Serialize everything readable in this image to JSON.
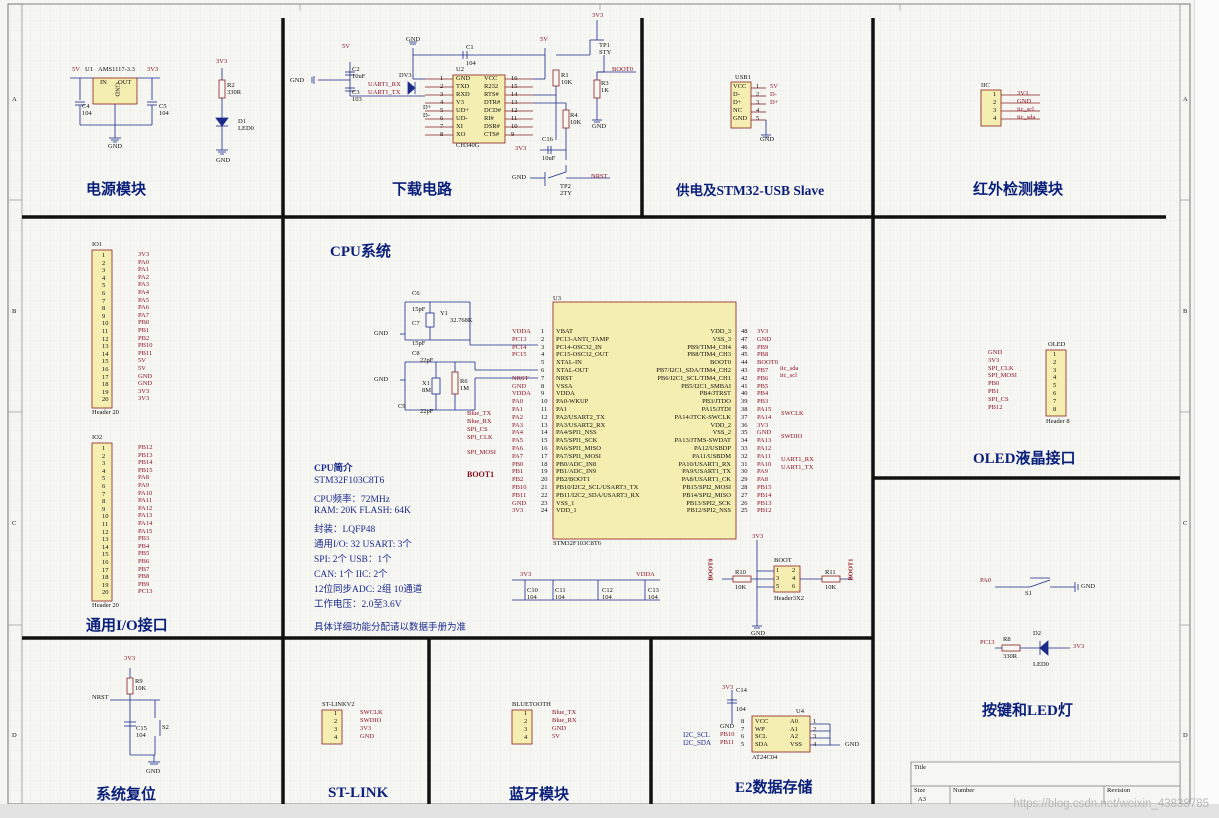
{
  "sheet": {
    "border_rows": [
      "A",
      "B",
      "C",
      "D"
    ],
    "watermark": "https://blog.csdn.net/weixin_43838785"
  },
  "sections": {
    "power": "电源模块",
    "download": "下载电路",
    "usb": "供电及STM32-USB Slave",
    "ir": "红外检测模块",
    "cpu": "CPU系统",
    "oled": "OLED液晶接口",
    "io": "通用I/O接口",
    "keyled": "按键和LED灯",
    "reset": "系统复位",
    "stlink": "ST-LINK",
    "bluetooth": "蓝牙模块",
    "e2": "E2数据存储"
  },
  "cpu_info": {
    "heading": "CPU简介",
    "lines": [
      "STM32F103C8T6",
      "CPU频率：72MHz",
      "RAM:  20K  FLASH:  64K",
      "封装：LQFP48",
      "通用I/O:  32      USART:  3个",
      "SPI:  2个            USB：1个",
      "CAN:  1个           IIC:  2个",
      "12位同步ADC:  2组  10通道",
      "工作电压：2.0至3.6V",
      "具体详细功能分配请以数据手册为准"
    ]
  },
  "power_parts": {
    "ldo": "AMS1117-3.3",
    "u1": "U1",
    "in": "IN",
    "out": "OUT",
    "gnd_pin": "GND",
    "v5": "5V",
    "v33": "3V3",
    "c4": "C4",
    "c4v": "104",
    "c5": "C5",
    "c5v": "104",
    "r2": "R2",
    "r2v": "330R",
    "d1": "D1",
    "d1v": "LED0",
    "gnd": "GND"
  },
  "download_parts": {
    "u2": "U2",
    "u2v": "CH340G",
    "left_pins": [
      "GND",
      "TXD",
      "RXD",
      "V3",
      "UD+",
      "UD-",
      "XI",
      "XO"
    ],
    "right_pins": [
      "VCC",
      "R232",
      "RTS#",
      "DTR#",
      "DCD#",
      "RI#",
      "DSR#",
      "CTS#"
    ],
    "left_nums": [
      "1",
      "2",
      "3",
      "4",
      "5",
      "6",
      "7",
      "8"
    ],
    "right_nums": [
      "16",
      "15",
      "14",
      "13",
      "12",
      "11",
      "10",
      "9"
    ],
    "uart_rx": "UART1_RX",
    "uart_tx": "UART1_TX",
    "dv3": "DV3",
    "c1": "C1",
    "c1v": "104",
    "c2": "C2",
    "c2v": "10uF",
    "c3": "C3",
    "c3v": "103",
    "c16": "C16",
    "c16v": "10uF",
    "r1": "R1",
    "r1v": "10K",
    "r3": "R3",
    "r3v": "1K",
    "r4": "R4",
    "r4v": "10K",
    "tp1": "TP1",
    "tp1v": "STY",
    "tp2": "TP2",
    "tp2v": "2TY",
    "boot0": "BOOT0",
    "nrst": "NRST",
    "v5": "5V",
    "v33": "3V3",
    "gnd": "GND",
    "dplus": "D+",
    "dminus": "D-"
  },
  "usb_parts": {
    "usb1": "USB1",
    "pins": [
      "VCC",
      "D-",
      "D+",
      "NC",
      "GND"
    ],
    "nums": [
      "1",
      "2",
      "3",
      "4",
      "5"
    ],
    "nets": [
      "5V",
      "D-",
      "D+",
      "",
      ""
    ],
    "gnd": "GND"
  },
  "ir_parts": {
    "iic": "IIC",
    "nums": [
      "1",
      "2",
      "3",
      "4"
    ],
    "nets": [
      "3V3",
      "GND",
      "iic_scl",
      "iic_sda"
    ]
  },
  "cpu_parts": {
    "u3": "U3",
    "u3v": "STM32F103C8T6",
    "left_pins": [
      "VBAT",
      "PC13-ANTI_TAMP",
      "PC14-OSC32_IN",
      "PC15-OSC32_OUT",
      "XTAL-IN",
      "XTAL-OUT",
      "NRST",
      "VSSA",
      "VDDA",
      "PA0-WKUP",
      "PA1",
      "PA2/USART2_TX",
      "PA3/USART2_RX",
      "PA4/SPI1_NSS",
      "PA5/SPI1_SCK",
      "PA6/SPI1_MISO",
      "PA7/SPI1_MOSI",
      "PB0/ADC_IN8",
      "PB1/ADC_IN9",
      "PB2/BOOT1",
      "PB10/I2C2_SCL/USART3_TX",
      "PB11/I2C2_SDA/USART3_RX",
      "VSS_1",
      "VDD_1"
    ],
    "left_nums": [
      "1",
      "2",
      "3",
      "4",
      "5",
      "6",
      "7",
      "8",
      "9",
      "10",
      "11",
      "12",
      "13",
      "14",
      "15",
      "16",
      "17",
      "18",
      "19",
      "20",
      "21",
      "22",
      "23",
      "24"
    ],
    "left_nets": [
      "VDDA",
      "PC13",
      "PC14",
      "PC15",
      "",
      "",
      "NRST",
      "GND",
      "VDDA",
      "PA0",
      "PA1",
      "PA2",
      "PA3",
      "PA4",
      "PA5",
      "PA6",
      "PA7",
      "PB0",
      "PB1",
      "PB2",
      "PB10",
      "PB11",
      "GND",
      "3V3"
    ],
    "right_pins": [
      "VDD_3",
      "VSS_3",
      "PB9/TIM4_CH4",
      "PB8/TIM4_CH3",
      "BOOT0",
      "PB7/I2C1_SDA/TIM4_CH2",
      "PB6/I2C1_SCL/TIM4_CH1",
      "PB5/I2C1_SMBAI",
      "PB4/JTRST",
      "PB3/JTDO",
      "PA15/JTDI",
      "PA14/JTCK-SWCLK",
      "VDD_2",
      "VSS_2",
      "PA13/JTMS-SWDAT",
      "PA12/USBDP",
      "PA11/USBDM",
      "PA10/USART1_RX",
      "PA9/USART1_TX",
      "PA8/USART1_CK",
      "PB15/SPI2_MOSI",
      "PB14/SPI2_MISO",
      "PB13/SPI2_SCK",
      "PB12/SPI2_NSS"
    ],
    "right_nums": [
      "48",
      "47",
      "46",
      "45",
      "44",
      "43",
      "42",
      "41",
      "40",
      "39",
      "38",
      "37",
      "36",
      "35",
      "34",
      "33",
      "32",
      "31",
      "30",
      "29",
      "28",
      "27",
      "26",
      "25"
    ],
    "right_nets": [
      "3V3",
      "GND",
      "PB9",
      "PB8",
      "BOOT0",
      "PB7",
      "PB6",
      "PB5",
      "PB4",
      "PB3",
      "PA15",
      "PA14",
      "3V3",
      "GND",
      "PA13",
      "PA12",
      "PA11",
      "PA10",
      "PA9",
      "PA8",
      "PB15",
      "PB14",
      "PB13",
      "PB12"
    ],
    "left_sig": {
      "blue_tx": "Blue_TX",
      "blue_rx": "Blue_RX",
      "spi_cs": "SPI_CS",
      "spi_clk": "SPI_CLK",
      "spi_mosi": "SPI_MOSI",
      "boot1": "BOOT1"
    },
    "right_sig": {
      "iic_sda": "iic_sda",
      "iic_scl": "iic_scl",
      "swclk": "SWCLK",
      "swdio": "SWDIO",
      "u1rx": "UART1_RX",
      "u1tx": "UART1_TX"
    },
    "c6": "C6",
    "c6v": "15pF",
    "c7": "C7",
    "c7v": "15pF",
    "y1": "Y1",
    "y1v": "32.768K",
    "c8": "C8",
    "c8v": "22pF",
    "c9": "C9",
    "c9v": "22pF",
    "x1": "X1",
    "x1v": "8M",
    "r6": "R6",
    "r6v": "1M",
    "caps": [
      "C10",
      "C11",
      "C12",
      "C13"
    ],
    "capv": "104",
    "v33": "3V3",
    "vdda": "VDDA",
    "gnd": "GND",
    "boot_hdr": "BOOT",
    "boot_hdr_v": "Header3X2",
    "r10": "R10",
    "r10v": "10K",
    "r11": "R11",
    "r11v": "10K",
    "boot0": "BOOT0",
    "boot1": "BOOT1",
    "boot_nums": [
      "1",
      "2",
      "3",
      "4",
      "5",
      "6"
    ]
  },
  "io_parts": {
    "io1": "IO1",
    "io1_nets": [
      "3V3",
      "PA0",
      "PA1",
      "PA2",
      "PA3",
      "PA4",
      "PA5",
      "PA6",
      "PA7",
      "PB0",
      "PB1",
      "PB2",
      "PB10",
      "PB11",
      "5V",
      "5V",
      "GND",
      "GND",
      "3V3",
      "3V3"
    ],
    "io1_foot": "Header 20",
    "io2": "IO2",
    "io2_nets": [
      "PB12",
      "PB13",
      "PB14",
      "PB15",
      "PA8",
      "PA9",
      "PA10",
      "PA11",
      "PA12",
      "PA13",
      "PA14",
      "PA15",
      "PB3",
      "PB4",
      "PB5",
      "PB6",
      "PB7",
      "PB8",
      "PB9",
      "PC13"
    ],
    "io2_foot": "Header 20"
  },
  "oled_parts": {
    "oled": "OLED",
    "nets": [
      "GND",
      "3V3",
      "SPI_CLK",
      "SPI_MOSI",
      "PB0",
      "PB1",
      "SPI_CS",
      "PB12"
    ],
    "nums": [
      "1",
      "2",
      "3",
      "4",
      "5",
      "6",
      "7",
      "8"
    ],
    "foot": "Header 8"
  },
  "keyled_parts": {
    "pa0": "PA0",
    "s1": "S1",
    "gnd": "GND",
    "pc13": "PC13",
    "r8": "R8",
    "r8v": "330R",
    "d2": "D2",
    "d2v": "LED0",
    "v33": "3V3"
  },
  "reset_parts": {
    "v33": "3V3",
    "r9": "R9",
    "r9v": "10K",
    "nrst": "NRST",
    "c15": "C15",
    "c15v": "104",
    "s2": "S2",
    "gnd": "GND"
  },
  "stlink_parts": {
    "name": "ST-LINKV2",
    "nums": [
      "1",
      "2",
      "3",
      "4"
    ],
    "nets": [
      "SWCLK",
      "SWDIO",
      "3V3",
      "GND"
    ]
  },
  "bt_parts": {
    "name": "BLUETOOTH",
    "nums": [
      "1",
      "2",
      "3",
      "4"
    ],
    "nets": [
      "Blue_TX",
      "Blue_RX",
      "GND",
      "5V"
    ]
  },
  "e2_parts": {
    "v33": "3V3",
    "c14": "C14",
    "c14v": "104",
    "u4": "U4",
    "u4v": "AT24C04",
    "left": [
      "VCC",
      "WP",
      "SCL",
      "SDA"
    ],
    "right": [
      "A0",
      "A1",
      "A2",
      "VSS"
    ],
    "lnums": [
      "8",
      "7",
      "6",
      "5"
    ],
    "rnums": [
      "1",
      "2",
      "3",
      "4"
    ],
    "gnd": "GND",
    "pb10": "PB10",
    "pb11": "PB11",
    "scl": "I2C_SCL",
    "sda": "I2C_SDA"
  },
  "title_block": {
    "title": "Title",
    "size": "Size",
    "size_v": "A3",
    "number": "Number",
    "revision": "Revision"
  }
}
